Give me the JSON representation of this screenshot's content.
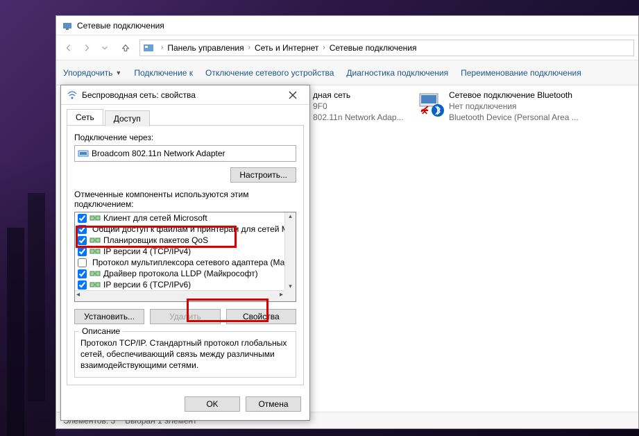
{
  "main_window": {
    "title": "Сетевые подключения",
    "breadcrumb": {
      "root": "Панель управления",
      "mid": "Сеть и Интернет",
      "leaf": "Сетевые подключения"
    },
    "toolbar": {
      "organize": "Упорядочить",
      "connect_to": "Подключение к",
      "disable": "Отключение сетевого устройства",
      "diagnose": "Диагностика подключения",
      "rename": "Переименование подключения"
    },
    "connections": {
      "wifi": {
        "name_suffix": "дная сеть",
        "line2": "9F0",
        "line3": "802.11n Network Adap..."
      },
      "bt": {
        "name": "Сетевое подключение Bluetooth",
        "status": "Нет подключения",
        "device": "Bluetooth Device (Personal Area ..."
      }
    },
    "statusbar": {
      "count": "Элементов: 3",
      "selected": "Выбран 1 элемент"
    }
  },
  "dialog": {
    "title": "Беспроводная сеть: свойства",
    "tabs": {
      "network": "Сеть",
      "access": "Доступ"
    },
    "connect_via_label": "Подключение через:",
    "adapter_name": "Broadcom 802.11n Network Adapter",
    "configure_btn": "Настроить...",
    "components_label": "Отмеченные компоненты используются этим подключением:",
    "components": [
      {
        "checked": true,
        "label": "Клиент для сетей Microsoft"
      },
      {
        "checked": true,
        "label": "Общий доступ к файлам и принтерам для сетей Mi"
      },
      {
        "checked": true,
        "label": "Планировщик пакетов QoS"
      },
      {
        "checked": true,
        "label": "IP версии 4 (TCP/IPv4)"
      },
      {
        "checked": false,
        "label": "Протокол мультиплексора сетевого адаптера (Ма"
      },
      {
        "checked": true,
        "label": "Драйвер протокола LLDP (Майкрософт)"
      },
      {
        "checked": true,
        "label": "IP версии 6 (TCP/IPv6)"
      }
    ],
    "install_btn": "Установить...",
    "uninstall_btn": "Удалить",
    "properties_btn": "Свойства",
    "description_legend": "Описание",
    "description_text": "Протокол TCP/IP. Стандартный протокол глобальных сетей, обеспечивающий связь между различными взаимодействующими сетями.",
    "ok_btn": "OK",
    "cancel_btn": "Отмена"
  }
}
